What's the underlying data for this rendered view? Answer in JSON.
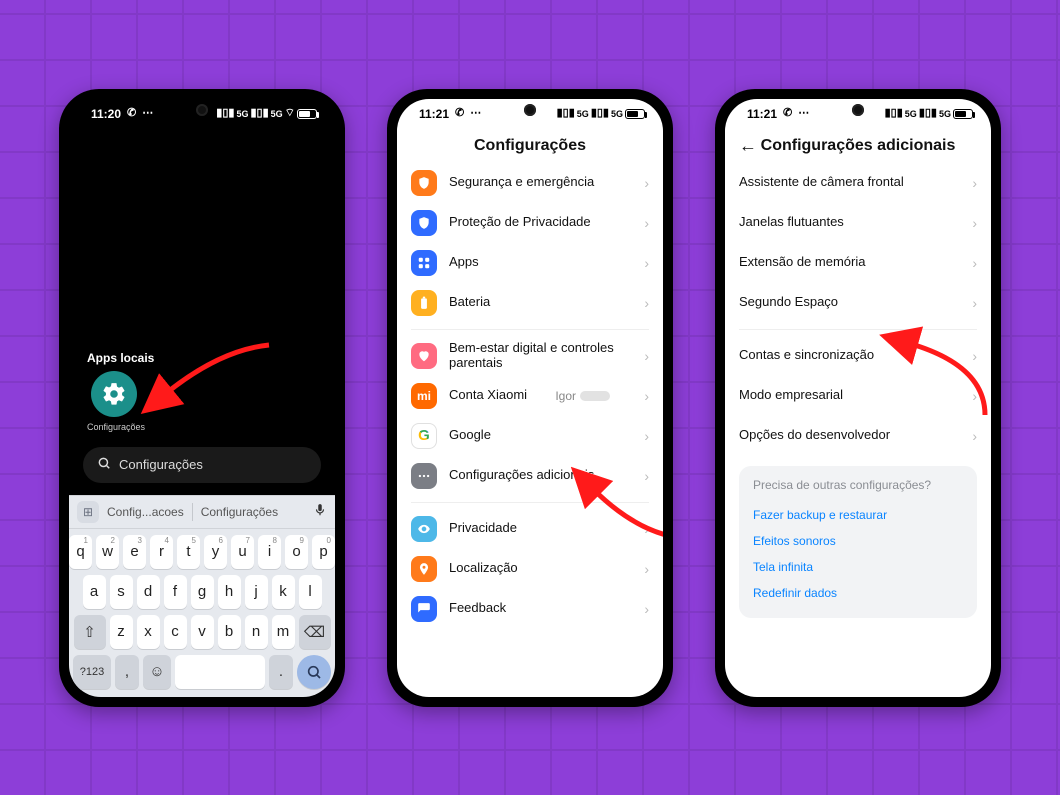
{
  "phone1": {
    "status": {
      "time": "11:20",
      "net": "5G",
      "batt": "80"
    },
    "section_header": "Apps locais",
    "app_label": "Configurações",
    "search_value": "Configurações",
    "suggestions": [
      "Config...acoes",
      "Configurações"
    ],
    "keyboard": {
      "row1": [
        [
          "q",
          "1"
        ],
        [
          "w",
          "2"
        ],
        [
          "e",
          "3"
        ],
        [
          "r",
          "4"
        ],
        [
          "t",
          "5"
        ],
        [
          "y",
          "6"
        ],
        [
          "u",
          "7"
        ],
        [
          "i",
          "8"
        ],
        [
          "o",
          "9"
        ],
        [
          "p",
          "0"
        ]
      ],
      "row2": [
        "a",
        "s",
        "d",
        "f",
        "g",
        "h",
        "j",
        "k",
        "l"
      ],
      "row3_letters": [
        "z",
        "x",
        "c",
        "v",
        "b",
        "n",
        "m"
      ],
      "numkey": "?123"
    }
  },
  "phone2": {
    "status": {
      "time": "11:21",
      "net": "5G",
      "batt": "80"
    },
    "title": "Configurações",
    "group1": [
      {
        "icon": "shield",
        "cls": "ic-orange",
        "label": "Segurança e emergência"
      },
      {
        "icon": "shield",
        "cls": "ic-blue",
        "label": "Proteção de Privacidade"
      },
      {
        "icon": "apps",
        "cls": "ic-blue",
        "label": "Apps"
      },
      {
        "icon": "battery",
        "cls": "ic-yellow",
        "label": "Bateria"
      }
    ],
    "group2": [
      {
        "icon": "heart",
        "cls": "ic-pink",
        "label": "Bem-estar digital e controles parentais"
      },
      {
        "icon": "mi",
        "cls": "ic-mi",
        "label": "Conta Xiaomi",
        "value": "Igor"
      },
      {
        "icon": "google",
        "cls": "ic-google",
        "label": "Google"
      },
      {
        "icon": "dots",
        "cls": "ic-grey",
        "label": "Configurações adicionais"
      }
    ],
    "group3": [
      {
        "icon": "eye",
        "cls": "ic-cyan",
        "label": "Privacidade"
      },
      {
        "icon": "pin",
        "cls": "ic-loc",
        "label": "Localização"
      },
      {
        "icon": "feedback",
        "cls": "ic-fb",
        "label": "Feedback"
      }
    ]
  },
  "phone3": {
    "status": {
      "time": "11:21",
      "net": "5G",
      "batt": "80"
    },
    "title": "Configurações adicionais",
    "group1": [
      "Assistente de câmera frontal",
      "Janelas flutuantes",
      "Extensão de memória",
      "Segundo Espaço"
    ],
    "group2": [
      "Contas e sincronização",
      "Modo empresarial",
      "Opções do desenvolvedor"
    ],
    "card": {
      "question": "Precisa de outras configurações?",
      "links": [
        "Fazer backup e restaurar",
        "Efeitos sonoros",
        "Tela infinita",
        "Redefinir dados"
      ]
    }
  }
}
